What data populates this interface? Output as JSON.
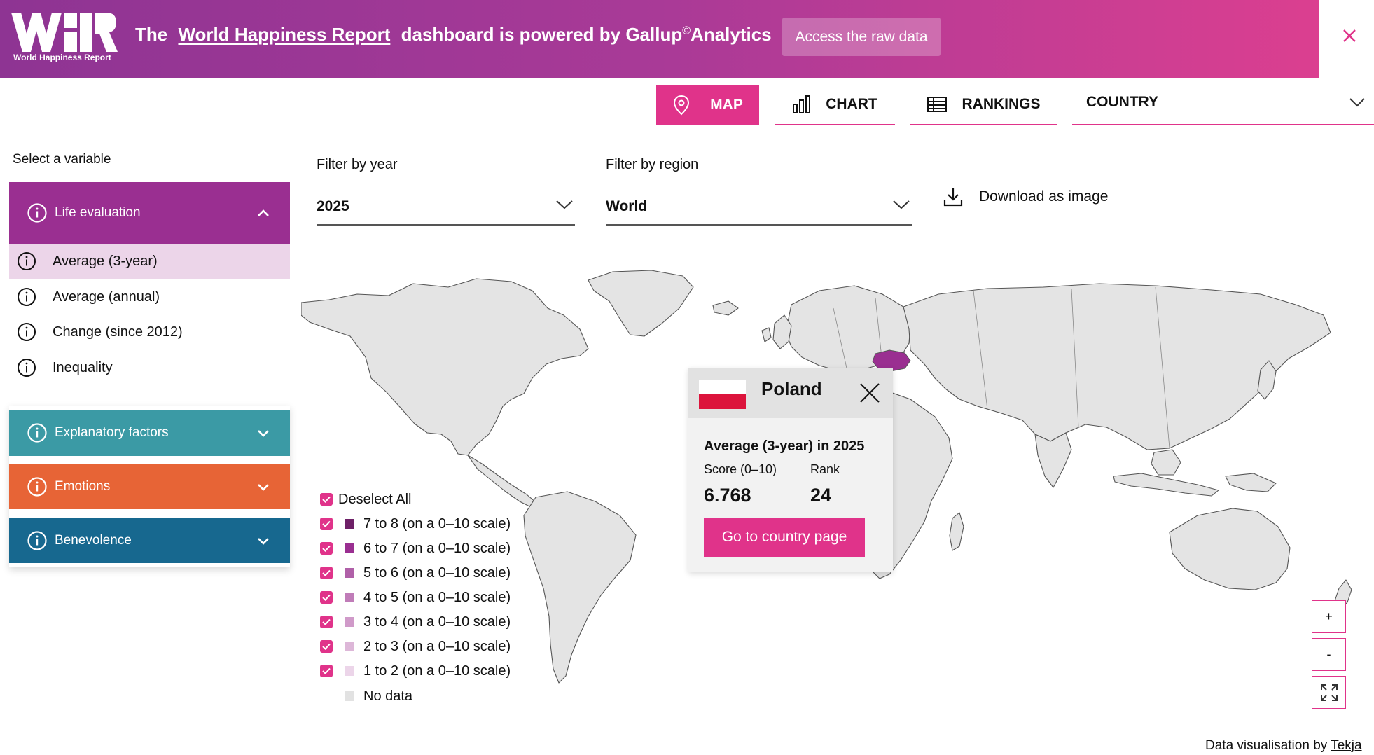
{
  "banner": {
    "logo_text": "WHR",
    "logo_caption": "World Happiness Report",
    "text_prefix": "The",
    "text_link": "World Happiness Report",
    "text_suffix": "dashboard is powered by Gallup",
    "text_symbol": "©",
    "text_end": "Analytics",
    "raw_data_button": "Access the raw data",
    "close_icon": "close-icon"
  },
  "tabs": {
    "map": "MAP",
    "chart": "CHART",
    "rankings": "RANKINGS",
    "country": "COUNTRY"
  },
  "sidebar": {
    "title": "Select a variable",
    "groups": [
      {
        "label": "Life evaluation",
        "color": "#9a2f91",
        "expanded": true,
        "items": [
          "Average (3-year)",
          "Average (annual)",
          "Change (since 2012)",
          "Inequality"
        ],
        "active_item": 0
      },
      {
        "label": "Explanatory factors",
        "color": "#3b9aa5",
        "expanded": false
      },
      {
        "label": "Emotions",
        "color": "#e76436",
        "expanded": false
      },
      {
        "label": "Benevolence",
        "color": "#17688f",
        "expanded": false
      }
    ]
  },
  "filters": {
    "year_label": "Filter by year",
    "year_value": "2025",
    "region_label": "Filter by region",
    "region_value": "World",
    "download_label": "Download as image"
  },
  "legend": {
    "deselect_all": "Deselect All",
    "items": [
      {
        "label": "7 to 8 (on a 0–10 scale)",
        "color": "#6e2067",
        "checked": true
      },
      {
        "label": "6 to 7 (on a 0–10 scale)",
        "color": "#9a2f91",
        "checked": true
      },
      {
        "label": "5 to 6 (on a 0–10 scale)",
        "color": "#b060a8",
        "checked": true
      },
      {
        "label": "4 to 5 (on a 0–10 scale)",
        "color": "#c07cb8",
        "checked": true
      },
      {
        "label": "3 to 4 (on a 0–10 scale)",
        "color": "#d09ac9",
        "checked": true
      },
      {
        "label": "2 to 3 (on a 0–10 scale)",
        "color": "#ddb7d8",
        "checked": true
      },
      {
        "label": "1 to 2 (on a 0–10 scale)",
        "color": "#ecd5e9",
        "checked": true
      },
      {
        "label": "No data",
        "color": "#e2e2e2",
        "checked": null
      }
    ]
  },
  "popup": {
    "country": "Poland",
    "metric": "Average (3-year) in 2025",
    "score_label": "Score (0–10)",
    "score_value": "6.768",
    "rank_label": "Rank",
    "rank_value": "24",
    "button": "Go to country page"
  },
  "map": {
    "highlight_country": "Poland",
    "highlight_color": "#9a2f91",
    "land_color": "#e4e4e4"
  },
  "zoom": {
    "in": "+",
    "out": "-"
  },
  "credit": {
    "prefix": "Data visualisation by",
    "link": "Tekja"
  }
}
